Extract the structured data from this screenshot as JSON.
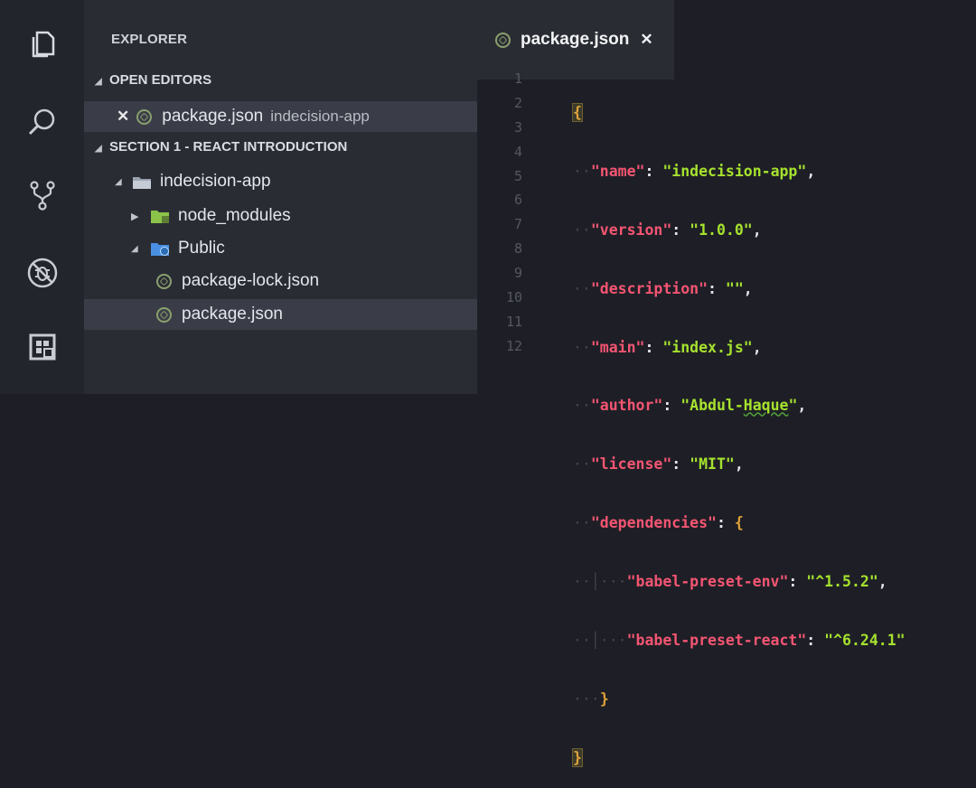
{
  "activity_bar": {
    "icons": [
      "files-icon",
      "search-icon",
      "source-control-icon",
      "debug-icon",
      "extensions-icon"
    ]
  },
  "sidebar": {
    "title": "EXPLORER",
    "open_editors_label": "OPEN EDITORS",
    "open_editors": [
      {
        "name": "package.json",
        "folder": "indecision-app"
      }
    ],
    "section_label": "SECTION 1 - REACT INTRODUCTION",
    "tree": {
      "root": "indecision-app",
      "items": [
        {
          "name": "node_modules",
          "type": "folder"
        },
        {
          "name": "Public",
          "type": "folder"
        },
        {
          "name": "package-lock.json",
          "type": "file"
        },
        {
          "name": "package.json",
          "type": "file",
          "selected": true
        }
      ]
    }
  },
  "editor": {
    "active_tab": "package.json",
    "line_numbers": [
      "1",
      "2",
      "3",
      "4",
      "5",
      "6",
      "7",
      "8",
      "9",
      "10",
      "11",
      "12"
    ],
    "code": {
      "name_key": "\"name\"",
      "name_val": "\"indecision-app\"",
      "version_key": "\"version\"",
      "version_val": "\"1.0.0\"",
      "description_key": "\"description\"",
      "description_val": "\"\"",
      "main_key": "\"main\"",
      "main_val": "\"index.js\"",
      "author_key": "\"author\"",
      "author_val_pre": "\"Abdul-",
      "author_val_sq": "Haque",
      "author_val_post": "\"",
      "license_key": "\"license\"",
      "license_val": "\"MIT\"",
      "deps_key": "\"dependencies\"",
      "dep1_key": "\"babel-preset-env\"",
      "dep1_val": "\"^1.5.2\"",
      "dep2_key": "\"babel-preset-react\"",
      "dep2_val": "\"^6.24.1\""
    }
  },
  "colors": {
    "keyword_key": "#f45572",
    "string": "#a6e22e",
    "brace": "#e0a33a",
    "background": "#1e1f26"
  }
}
